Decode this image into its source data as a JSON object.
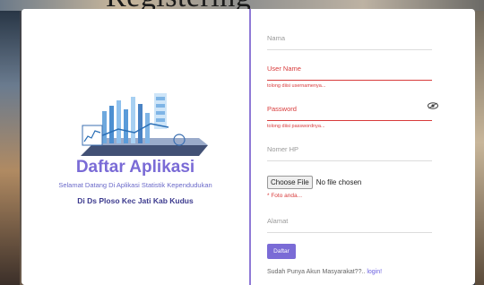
{
  "page": {
    "top_title_fragment": "Registering"
  },
  "brand": {
    "title": "Daftar Aplikasi",
    "subtitle": "Selamat Datang Di Aplikasi Statistik Kependudukan",
    "location": "Di Ds Ploso Kec Jati Kab Kudus",
    "accent_color": "#7a6bd6"
  },
  "form": {
    "nama": {
      "placeholder": "Nama"
    },
    "username": {
      "placeholder": "User Name",
      "error": "tolong diisi usernamenya..."
    },
    "password": {
      "placeholder": "Password",
      "error": "tolong diisi passwordnya...",
      "icon": "eye-icon"
    },
    "phone": {
      "placeholder": "Nomer HP"
    },
    "file": {
      "button_label": "Choose File",
      "status": "No file chosen",
      "hint": "* Foto anda..."
    },
    "alamat": {
      "placeholder": "Alamat"
    },
    "submit_label": "Daftar",
    "login_prompt": "Sudah Punya Akun Masyarakat??..",
    "login_link": "login!"
  },
  "colors": {
    "error": "#d83b3b",
    "divider": "#8f7ad6",
    "link": "#6a5fe0"
  }
}
